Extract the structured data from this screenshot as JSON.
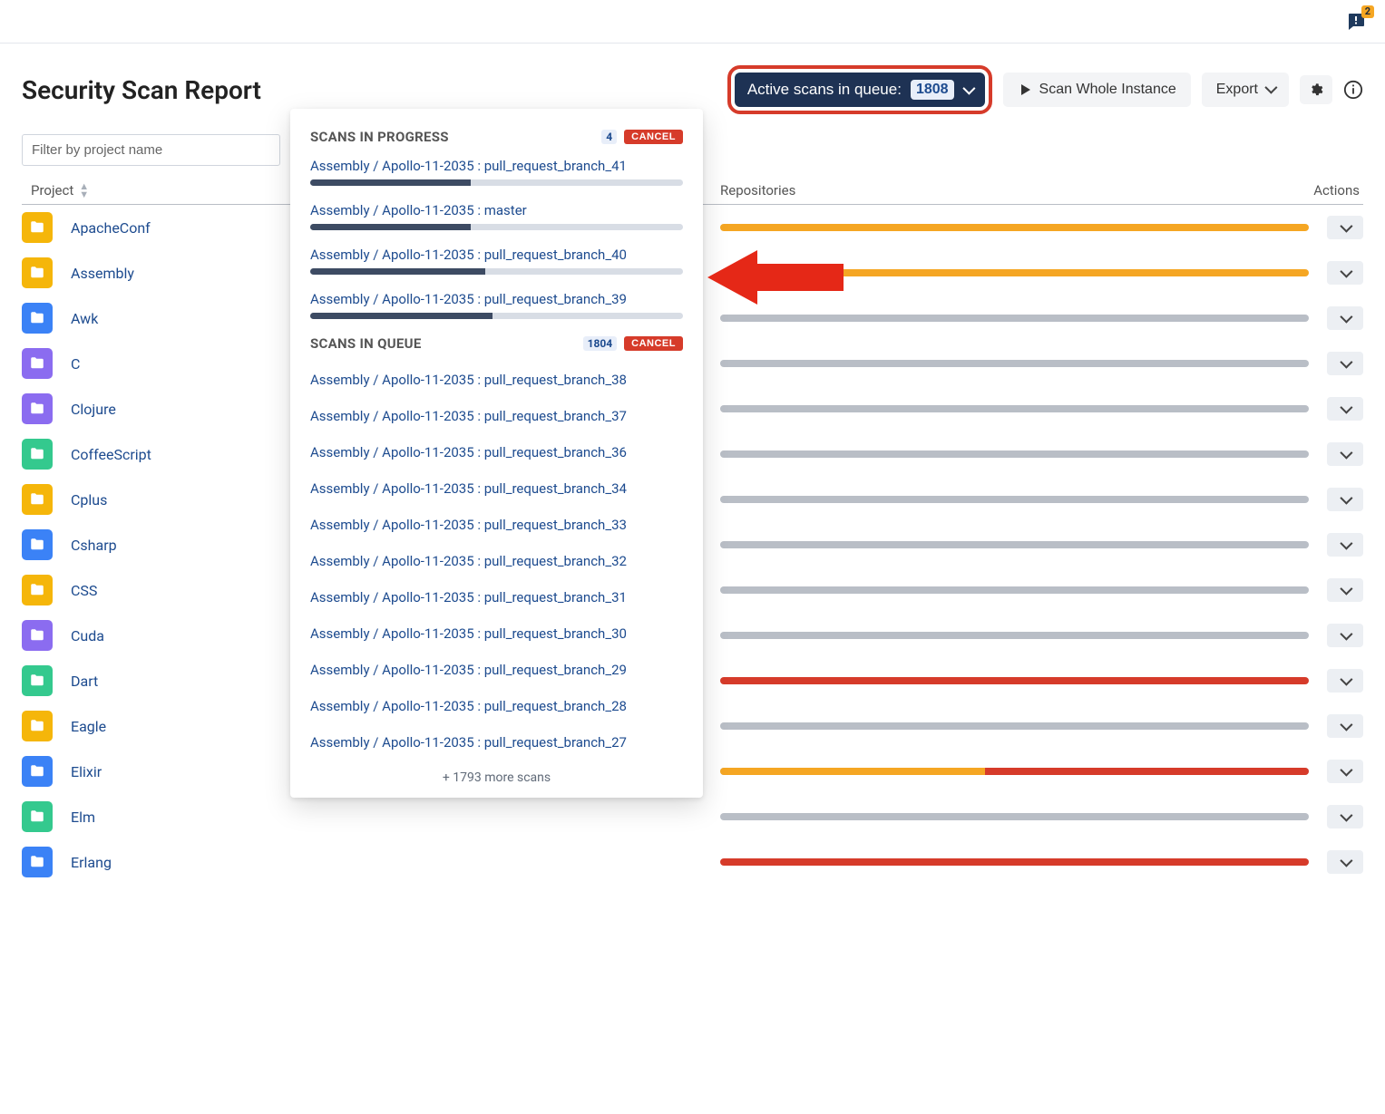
{
  "topbar": {
    "notifications": "2"
  },
  "header": {
    "title": "Security Scan Report",
    "queue_label": "Active scans in queue:",
    "queue_count": "1808",
    "scan_button": "Scan Whole Instance",
    "export_button": "Export"
  },
  "filter": {
    "placeholder": "Filter by project name"
  },
  "columns": {
    "project": "Project",
    "repositories": "Repositories",
    "actions": "Actions"
  },
  "projects": [
    {
      "name": "ApacheConf",
      "color": "f-yellow",
      "segments": [
        [
          "y",
          100
        ]
      ]
    },
    {
      "name": "Assembly",
      "color": "f-yellow",
      "segments": [
        [
          "y",
          100
        ]
      ]
    },
    {
      "name": "Awk",
      "color": "f-blue",
      "segments": [
        [
          "g",
          100
        ]
      ]
    },
    {
      "name": "C",
      "color": "f-purple",
      "segments": [
        [
          "g",
          100
        ]
      ]
    },
    {
      "name": "Clojure",
      "color": "f-purple",
      "segments": [
        [
          "g",
          100
        ]
      ]
    },
    {
      "name": "CoffeeScript",
      "color": "f-green",
      "segments": [
        [
          "g",
          100
        ]
      ]
    },
    {
      "name": "Cplus",
      "color": "f-yellow",
      "segments": [
        [
          "g",
          100
        ]
      ]
    },
    {
      "name": "Csharp",
      "color": "f-blue",
      "segments": [
        [
          "g",
          100
        ]
      ]
    },
    {
      "name": "CSS",
      "color": "f-yellow",
      "segments": [
        [
          "g",
          100
        ]
      ]
    },
    {
      "name": "Cuda",
      "color": "f-purple",
      "segments": [
        [
          "g",
          100
        ]
      ]
    },
    {
      "name": "Dart",
      "color": "f-green",
      "segments": [
        [
          "r",
          100
        ]
      ]
    },
    {
      "name": "Eagle",
      "color": "f-yellow",
      "segments": [
        [
          "g",
          100
        ]
      ]
    },
    {
      "name": "Elixir",
      "color": "f-blue",
      "segments": [
        [
          "y",
          45
        ],
        [
          "r",
          55
        ]
      ]
    },
    {
      "name": "Elm",
      "color": "f-green",
      "segments": [
        [
          "g",
          100
        ]
      ]
    },
    {
      "name": "Erlang",
      "color": "f-blue",
      "segments": [
        [
          "r",
          100
        ]
      ]
    }
  ],
  "dropdown": {
    "section_progress": "SCANS IN PROGRESS",
    "progress_count": "4",
    "cancel_label": "CANCEL",
    "progress_items": [
      {
        "label": "Assembly / Apollo-11-2035 : pull_request_branch_41",
        "pct": 43
      },
      {
        "label": "Assembly / Apollo-11-2035 : master",
        "pct": 43
      },
      {
        "label": "Assembly / Apollo-11-2035 : pull_request_branch_40",
        "pct": 47
      },
      {
        "label": "Assembly / Apollo-11-2035 : pull_request_branch_39",
        "pct": 49
      }
    ],
    "section_queue": "SCANS IN QUEUE",
    "queue_count": "1804",
    "queue_items": [
      "Assembly / Apollo-11-2035 : pull_request_branch_38",
      "Assembly / Apollo-11-2035 : pull_request_branch_37",
      "Assembly / Apollo-11-2035 : pull_request_branch_36",
      "Assembly / Apollo-11-2035 : pull_request_branch_34",
      "Assembly / Apollo-11-2035 : pull_request_branch_33",
      "Assembly / Apollo-11-2035 : pull_request_branch_32",
      "Assembly / Apollo-11-2035 : pull_request_branch_31",
      "Assembly / Apollo-11-2035 : pull_request_branch_30",
      "Assembly / Apollo-11-2035 : pull_request_branch_29",
      "Assembly / Apollo-11-2035 : pull_request_branch_28",
      "Assembly / Apollo-11-2035 : pull_request_branch_27"
    ],
    "more_text": "+ 1793 more scans"
  }
}
